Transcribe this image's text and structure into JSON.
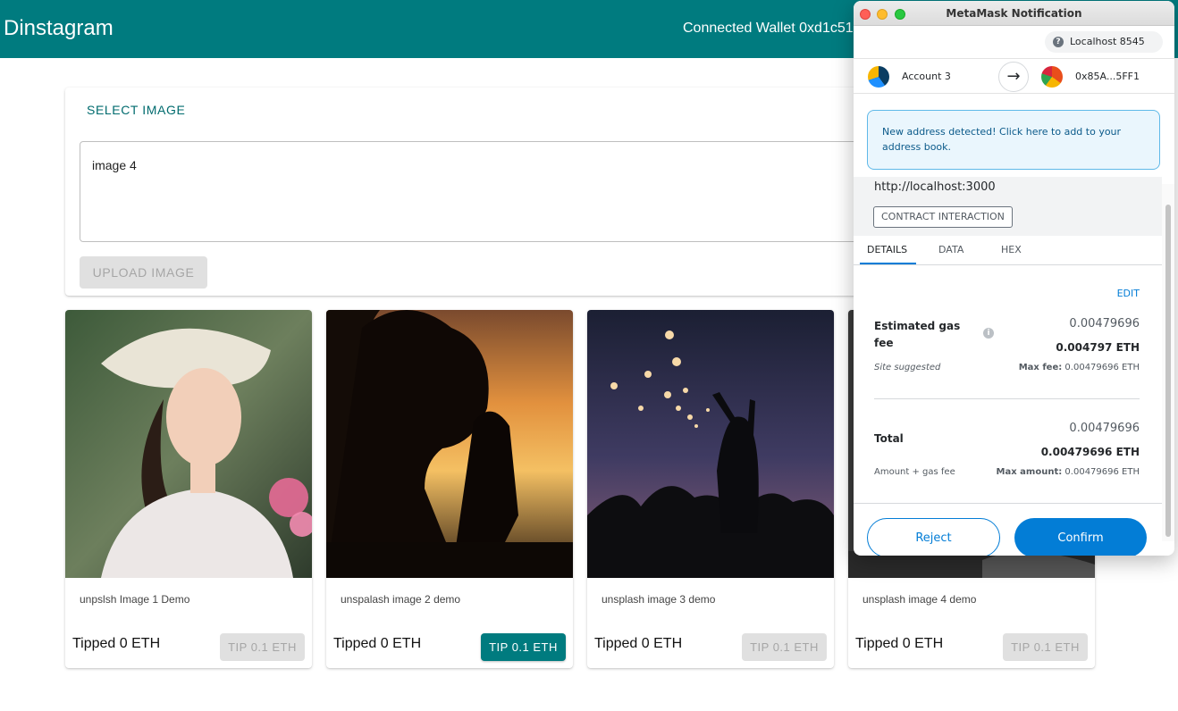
{
  "app": {
    "brand": "Dinstagram",
    "wallet_text": "Connected Wallet 0xd1c51"
  },
  "upload": {
    "select_label": "SELECT IMAGE",
    "description_value": "image 4",
    "upload_label": "UPLOAD IMAGE"
  },
  "cards": [
    {
      "caption": "unpslsh Image 1 Demo",
      "tipped": "Tipped 0 ETH",
      "tip_label": "TIP 0.1 ETH",
      "tip_enabled": false
    },
    {
      "caption": "unspalash image 2 demo",
      "tipped": "Tipped 0 ETH",
      "tip_label": "TIP 0.1 ETH",
      "tip_enabled": true
    },
    {
      "caption": "unsplash image 3 demo",
      "tipped": "Tipped 0 ETH",
      "tip_label": "TIP 0.1 ETH",
      "tip_enabled": false
    },
    {
      "caption": "unsplash image 4 demo",
      "tipped": "Tipped 0 ETH",
      "tip_label": "TIP 0.1 ETH",
      "tip_enabled": false
    }
  ],
  "metamask": {
    "title": "MetaMask Notification",
    "network": "Localhost 8545",
    "from_account": "Account 3",
    "to_address": "0x85A...5FF1",
    "alert_text": "New address detected! Click here to add to your address book.",
    "origin": "http://localhost:3000",
    "badge": "CONTRACT INTERACTION",
    "tabs": [
      "DETAILS",
      "DATA",
      "HEX"
    ],
    "edit_label": "EDIT",
    "gas_label": "Estimated gas fee",
    "gas_secondary": "0.00479696",
    "gas_primary": "0.004797 ETH",
    "site_suggested": "Site suggested",
    "max_fee_label": "Max fee:",
    "max_fee_value": "0.00479696 ETH",
    "total_label": "Total",
    "total_secondary": "0.00479696",
    "total_primary": "0.00479696 ETH",
    "amount_gas_label": "Amount + gas fee",
    "max_amount_label": "Max amount:",
    "max_amount_value": "0.00479696 ETH",
    "reject_label": "Reject",
    "confirm_label": "Confirm",
    "colors": {
      "accent": "#037dd6",
      "app_bar": "#007b7f"
    }
  }
}
